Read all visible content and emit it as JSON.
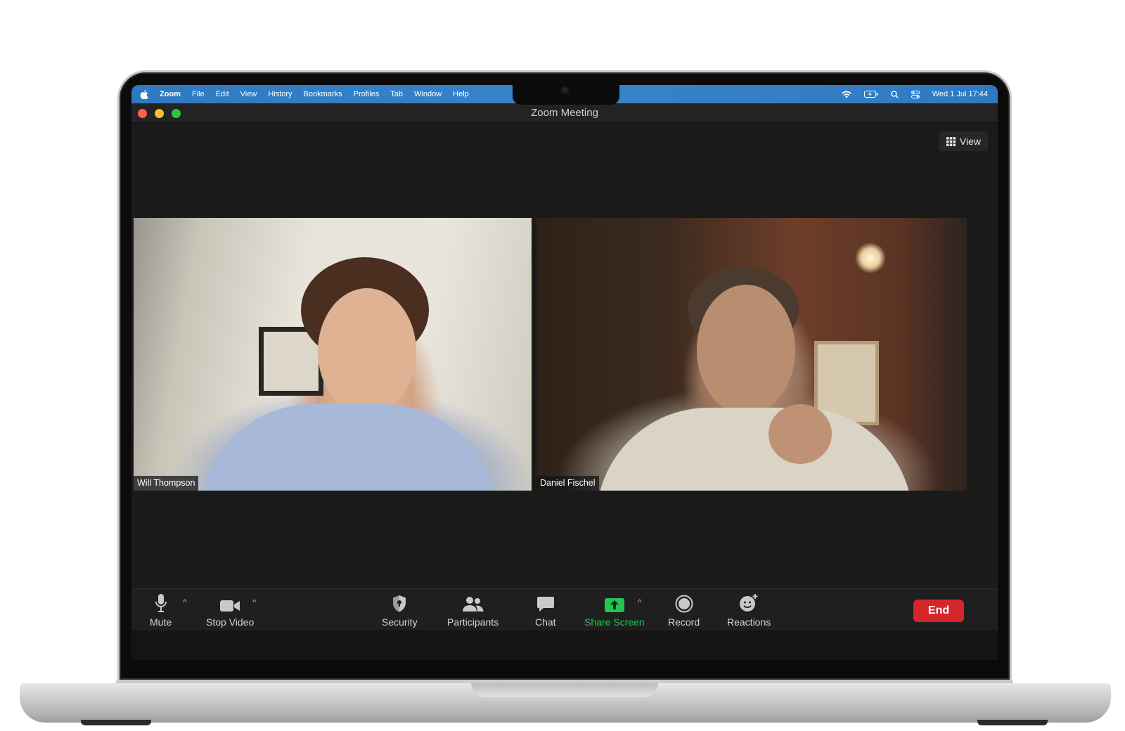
{
  "menubar": {
    "app_name": "Zoom",
    "items": [
      "File",
      "Edit",
      "View",
      "History",
      "Bookmarks",
      "Profiles",
      "Tab",
      "Window",
      "Help"
    ],
    "clock": "Wed 1 Jul  17:44"
  },
  "window": {
    "title": "Zoom Meeting",
    "view_label": "View"
  },
  "participants": [
    {
      "name": "Will Thompson"
    },
    {
      "name": "Daniel Fischel"
    }
  ],
  "toolbar": {
    "mute": "Mute",
    "stop_video": "Stop Video",
    "security": "Security",
    "participants": "Participants",
    "chat": "Chat",
    "share_screen": "Share Screen",
    "record": "Record",
    "reactions": "Reactions",
    "end": "End",
    "caret": "^"
  },
  "colors": {
    "menubar": "#2f79c0",
    "share_screen": "#23c552",
    "end_button": "#d6262b",
    "window_bg": "#1a1a1a"
  }
}
